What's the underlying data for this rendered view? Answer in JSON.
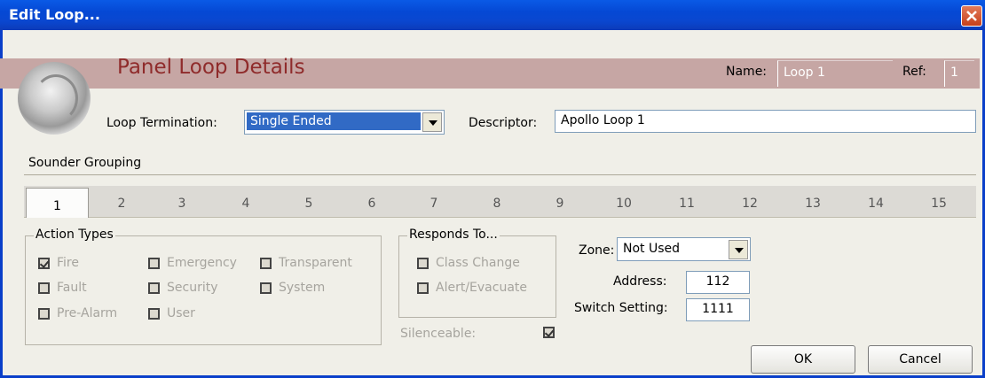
{
  "window": {
    "title": "Edit Loop..."
  },
  "header": {
    "title": "Panel Loop Details",
    "name_label": "Name:",
    "name_value": "Loop 1",
    "ref_label": "Ref:",
    "ref_value": "1"
  },
  "loop_termination": {
    "label": "Loop Termination:",
    "value": "Single Ended"
  },
  "descriptor": {
    "label": "Descriptor:",
    "value": "Apollo Loop 1"
  },
  "sounder_grouping": {
    "label": "Sounder Grouping"
  },
  "tabs": [
    "1",
    "2",
    "3",
    "4",
    "5",
    "6",
    "7",
    "8",
    "9",
    "10",
    "11",
    "12",
    "13",
    "14",
    "15"
  ],
  "active_tab": "1",
  "action_types": {
    "legend": "Action Types",
    "items": [
      {
        "label": "Fire",
        "checked": true
      },
      {
        "label": "Emergency",
        "checked": false
      },
      {
        "label": "Transparent",
        "checked": false
      },
      {
        "label": "Fault",
        "checked": false
      },
      {
        "label": "Security",
        "checked": false
      },
      {
        "label": "System",
        "checked": false
      },
      {
        "label": "Pre-Alarm",
        "checked": false
      },
      {
        "label": "User",
        "checked": false
      }
    ]
  },
  "responds_to": {
    "legend": "Responds To...",
    "items": [
      {
        "label": "Class Change",
        "checked": false
      },
      {
        "label": "Alert/Evacuate",
        "checked": false
      }
    ]
  },
  "zone": {
    "label": "Zone:",
    "value": "Not Used"
  },
  "address": {
    "label": "Address:",
    "value": "112"
  },
  "switch_setting": {
    "label": "Switch Setting:",
    "value": "1111"
  },
  "silenceable": {
    "label": "Silenceable:",
    "checked": true
  },
  "buttons": {
    "ok": "OK",
    "cancel": "Cancel"
  },
  "colors": {
    "title_bar": "#0548d4",
    "banner": "#c6a6a4",
    "banner_text": "#8f2b2b",
    "selection": "#316ac5"
  }
}
